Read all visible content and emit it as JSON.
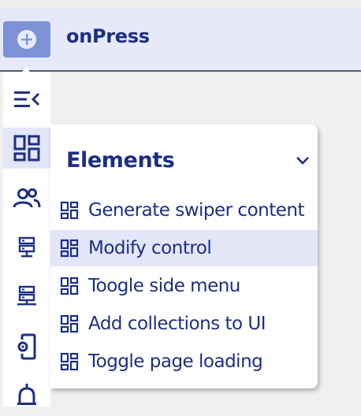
{
  "app": {
    "title": "onPress"
  },
  "colors": {
    "brand": "#1c2f83",
    "logo_bg": "#7d92d6",
    "active_bg": "#e2e6f7"
  },
  "sidebar": {
    "items": [
      {
        "icon": "collapse-menu-icon"
      },
      {
        "icon": "elements-grid-icon",
        "active": true
      },
      {
        "icon": "users-icon"
      },
      {
        "icon": "server-icon"
      },
      {
        "icon": "network-server-icon"
      },
      {
        "icon": "mobile-settings-icon"
      },
      {
        "icon": "bell-icon"
      }
    ]
  },
  "menu": {
    "title": "Elements",
    "items": [
      {
        "label": "Generate swiper content",
        "icon": "element-grid-icon"
      },
      {
        "label": "Modify control",
        "icon": "element-grid-icon",
        "hover": true
      },
      {
        "label": "Toogle side menu",
        "icon": "element-grid-icon"
      },
      {
        "label": "Add collections to UI",
        "icon": "element-grid-icon"
      },
      {
        "label": "Toggle page loading",
        "icon": "element-grid-icon"
      }
    ]
  }
}
